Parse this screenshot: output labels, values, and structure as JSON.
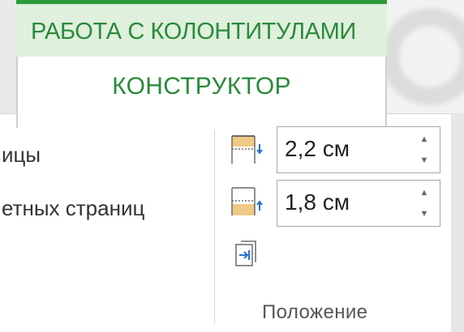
{
  "context_group": {
    "title": "РАБОТА С КОЛОНТИТУЛАМИ"
  },
  "active_tab": {
    "label": "КОНСТРУКТОР"
  },
  "options": [
    {
      "label": "ицы"
    },
    {
      "label": "етных страниц"
    }
  ],
  "position": {
    "header_from_top": {
      "value": "2,2 см",
      "icon": "header-position-icon"
    },
    "footer_from_bottom": {
      "value": "1,8 см",
      "icon": "footer-position-icon"
    },
    "insert_alignment_tab": {
      "icon": "insert-alignment-tab-icon"
    },
    "group_label": "Положение"
  },
  "colors": {
    "accent_green": "#2a8a3a",
    "context_bg": "#dff0dd",
    "header_shade": "#f0c886"
  }
}
